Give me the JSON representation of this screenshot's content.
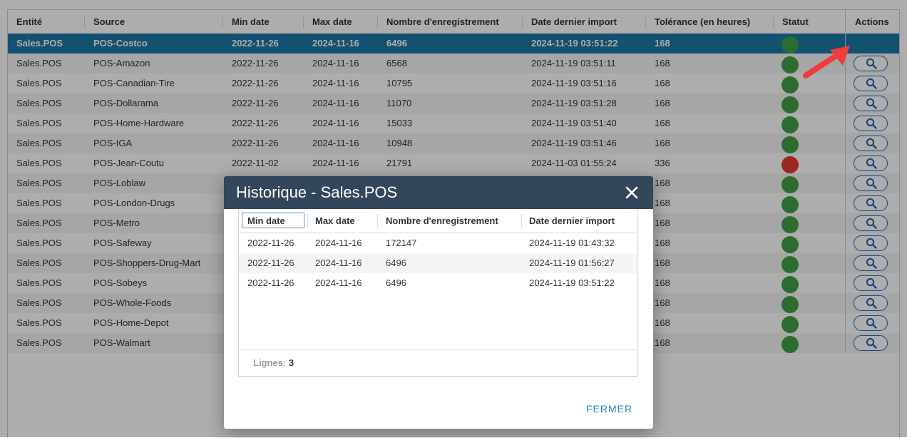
{
  "grid": {
    "columns": [
      "Entité",
      "Source",
      "Min date",
      "Max date",
      "Nombre d'enregistrement",
      "Date dernier import",
      "Tolérance (en heures)",
      "Statut",
      "Actions"
    ],
    "rows": [
      {
        "entite": "Sales.POS",
        "source": "POS-Costco",
        "min": "2022-11-26",
        "max": "2024-11-16",
        "count": "6496",
        "last": "2024-11-19 03:51:22",
        "tol": "168",
        "status": "ok",
        "selected": true
      },
      {
        "entite": "Sales.POS",
        "source": "POS-Amazon",
        "min": "2022-11-26",
        "max": "2024-11-16",
        "count": "6568",
        "last": "2024-11-19 03:51:11",
        "tol": "168",
        "status": "ok"
      },
      {
        "entite": "Sales.POS",
        "source": "POS-Canadian-Tire",
        "min": "2022-11-26",
        "max": "2024-11-16",
        "count": "10795",
        "last": "2024-11-19 03:51:16",
        "tol": "168",
        "status": "ok"
      },
      {
        "entite": "Sales.POS",
        "source": "POS-Dollarama",
        "min": "2022-11-26",
        "max": "2024-11-16",
        "count": "11070",
        "last": "2024-11-19 03:51:28",
        "tol": "168",
        "status": "ok"
      },
      {
        "entite": "Sales.POS",
        "source": "POS-Home-Hardware",
        "min": "2022-11-26",
        "max": "2024-11-16",
        "count": "15033",
        "last": "2024-11-19 03:51:40",
        "tol": "168",
        "status": "ok"
      },
      {
        "entite": "Sales.POS",
        "source": "POS-IGA",
        "min": "2022-11-26",
        "max": "2024-11-16",
        "count": "10948",
        "last": "2024-11-19 03:51:46",
        "tol": "168",
        "status": "ok"
      },
      {
        "entite": "Sales.POS",
        "source": "POS-Jean-Coutu",
        "min": "2022-11-02",
        "max": "2024-11-16",
        "count": "21791",
        "last": "2024-11-03 01:55:24",
        "tol": "336",
        "status": "bad"
      },
      {
        "entite": "Sales.POS",
        "source": "POS-Loblaw",
        "min": "",
        "max": "",
        "count": "",
        "last": "",
        "tol": "168",
        "status": "ok"
      },
      {
        "entite": "Sales.POS",
        "source": "POS-London-Drugs",
        "min": "",
        "max": "",
        "count": "",
        "last": "",
        "tol": "168",
        "status": "ok"
      },
      {
        "entite": "Sales.POS",
        "source": "POS-Metro",
        "min": "",
        "max": "",
        "count": "",
        "last": "",
        "tol": "168",
        "status": "ok"
      },
      {
        "entite": "Sales.POS",
        "source": "POS-Safeway",
        "min": "",
        "max": "",
        "count": "",
        "last": "",
        "tol": "168",
        "status": "ok"
      },
      {
        "entite": "Sales.POS",
        "source": "POS-Shoppers-Drug-Mart",
        "min": "",
        "max": "",
        "count": "",
        "last": "",
        "tol": "168",
        "status": "ok"
      },
      {
        "entite": "Sales.POS",
        "source": "POS-Sobeys",
        "min": "",
        "max": "",
        "count": "",
        "last": "",
        "tol": "168",
        "status": "ok"
      },
      {
        "entite": "Sales.POS",
        "source": "POS-Whole-Foods",
        "min": "",
        "max": "",
        "count": "",
        "last": "",
        "tol": "168",
        "status": "ok"
      },
      {
        "entite": "Sales.POS",
        "source": "POS-Home-Depot",
        "min": "",
        "max": "",
        "count": "",
        "last": "",
        "tol": "168",
        "status": "ok"
      },
      {
        "entite": "Sales.POS",
        "source": "POS-Walmart",
        "min": "",
        "max": "",
        "count": "",
        "last": "",
        "tol": "168",
        "status": "ok"
      }
    ]
  },
  "modal": {
    "title": "Historique - Sales.POS",
    "columns": [
      "Min date",
      "Max date",
      "Nombre d'enregistrement",
      "Date dernier import"
    ],
    "rows": [
      {
        "min": "2022-11-26",
        "max": "2024-11-16",
        "count": "172147",
        "last": "2024-11-19 01:43:32"
      },
      {
        "min": "2022-11-26",
        "max": "2024-11-16",
        "count": "6496",
        "last": "2024-11-19 01:56:27"
      },
      {
        "min": "2022-11-26",
        "max": "2024-11-16",
        "count": "6496",
        "last": "2024-11-19 03:51:22"
      }
    ],
    "footer_label": "Lignes:",
    "footer_count": "3",
    "close_label": "FERMER"
  },
  "colors": {
    "selected_row": "#1b78a6",
    "status_ok": "#43a047",
    "status_bad": "#e53935",
    "modal_header": "#33475b",
    "accent": "#1e88c7",
    "arrow": "#f03c3c"
  },
  "icons": {
    "search": "search-icon",
    "close": "close-icon",
    "pointer": "arrow-pointer-icon"
  }
}
